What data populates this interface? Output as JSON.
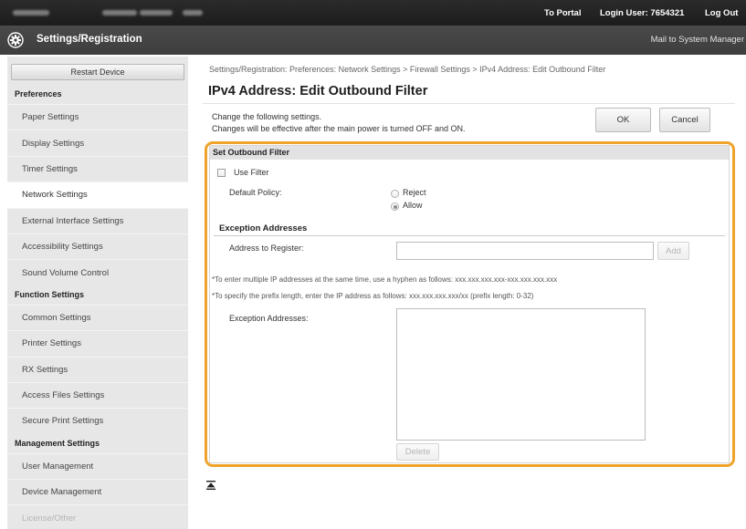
{
  "topbar": {
    "portal_link": "To Portal",
    "login_user": "Login User: 7654321",
    "logout_link": "Log Out"
  },
  "appbar": {
    "icon": "settings-gear-icon",
    "title": "Settings/Registration",
    "mail_link": "Mail to System Manager"
  },
  "sidebar": {
    "restart_label": "Restart Device",
    "groups": [
      {
        "title": "Preferences",
        "items": [
          {
            "label": "Paper Settings"
          },
          {
            "label": "Display Settings"
          },
          {
            "label": "Timer Settings"
          },
          {
            "label": "Network Settings",
            "selected": true
          },
          {
            "label": "External Interface Settings"
          },
          {
            "label": "Accessibility Settings"
          },
          {
            "label": "Sound Volume Control"
          }
        ]
      },
      {
        "title": "Function Settings",
        "items": [
          {
            "label": "Common Settings"
          },
          {
            "label": "Printer Settings"
          },
          {
            "label": "RX Settings"
          },
          {
            "label": "Access Files Settings"
          },
          {
            "label": "Secure Print Settings"
          }
        ]
      },
      {
        "title": "Management Settings",
        "items": [
          {
            "label": "User Management"
          },
          {
            "label": "Device Management"
          },
          {
            "label": "License/Other"
          }
        ]
      }
    ]
  },
  "main": {
    "breadcrumb": "Settings/Registration: Preferences: Network Settings > Firewall Settings > IPv4 Address: Edit Outbound Filter",
    "title": "IPv4 Address: Edit Outbound Filter",
    "description": [
      "Change the following settings.",
      "Changes will be effective after the main power is turned OFF and ON."
    ],
    "ok_label": "OK",
    "cancel_label": "Cancel"
  },
  "outbound_filter": {
    "section_title": "Set Outbound Filter",
    "use_filter": {
      "label": "Use Filter",
      "checked": false
    },
    "default_policy": {
      "label": "Default Policy:",
      "options": [
        {
          "label": "Reject",
          "selected": false
        },
        {
          "label": "Allow",
          "selected": true
        }
      ]
    },
    "exception_addresses": {
      "heading": "Exception Addresses",
      "register_label": "Address to Register:",
      "add_label": "Add",
      "add_disabled": true,
      "notes": [
        "*To enter multiple IP addresses at the same time, use a hyphen as follows: xxx.xxx.xxx.xxx-xxx.xxx.xxx.xxx",
        "*To specify the prefix length, enter the IP address as follows: xxx.xxx.xxx.xxx/xx (prefix length: 0-32)"
      ],
      "list_label": "Exception Addresses:",
      "delete_label": "Delete",
      "delete_disabled": true
    }
  },
  "footer": {
    "back_to_top_icon": "back-to-top-icon"
  },
  "colors": {
    "accent_orange": "#f0a32a",
    "topbar_bg": "#1c1c1c",
    "appbar_bg": "#3e3e3e",
    "sidebar_bg": "#e7e7e7",
    "selected_item_bg": "#ffffff"
  }
}
